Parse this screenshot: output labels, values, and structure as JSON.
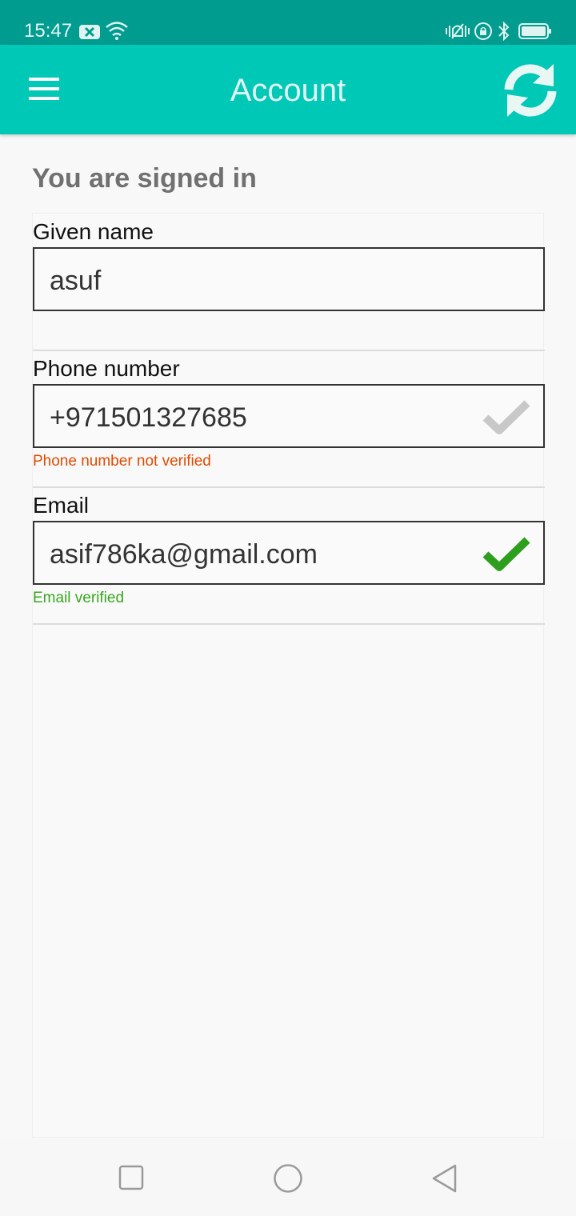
{
  "status_bar": {
    "time": "15:47",
    "icons": [
      "notification-x-icon",
      "wifi-icon",
      "vibrate-icon",
      "rotation-lock-icon",
      "bluetooth-icon",
      "battery-icon"
    ]
  },
  "app_bar": {
    "menu_icon": "hamburger-menu-icon",
    "title": "Account",
    "refresh_icon": "refresh-icon"
  },
  "content": {
    "heading": "You are signed in",
    "fields": [
      {
        "label": "Given name",
        "value": "asuf",
        "status": "",
        "status_color": "",
        "check_icon": ""
      },
      {
        "label": "Phone number",
        "value": "+971501327685",
        "status": "Phone number not verified",
        "status_color": "#e14a00",
        "check_icon": "check-gray-icon"
      },
      {
        "label": "Email",
        "value": "asif786ka@gmail.com",
        "status": "Email verified",
        "status_color": "#3aa621",
        "check_icon": "check-green-icon"
      }
    ]
  },
  "colors": {
    "status_bar": "#009c8f",
    "app_bar": "#00c8b6",
    "verified": "#3aa621",
    "unverified": "#e14a00",
    "check_unverified": "#c8c8c8",
    "check_verified": "#2e9e1f"
  },
  "nav_bar": {
    "icons": [
      "recent-apps-icon",
      "home-icon",
      "back-icon"
    ]
  }
}
